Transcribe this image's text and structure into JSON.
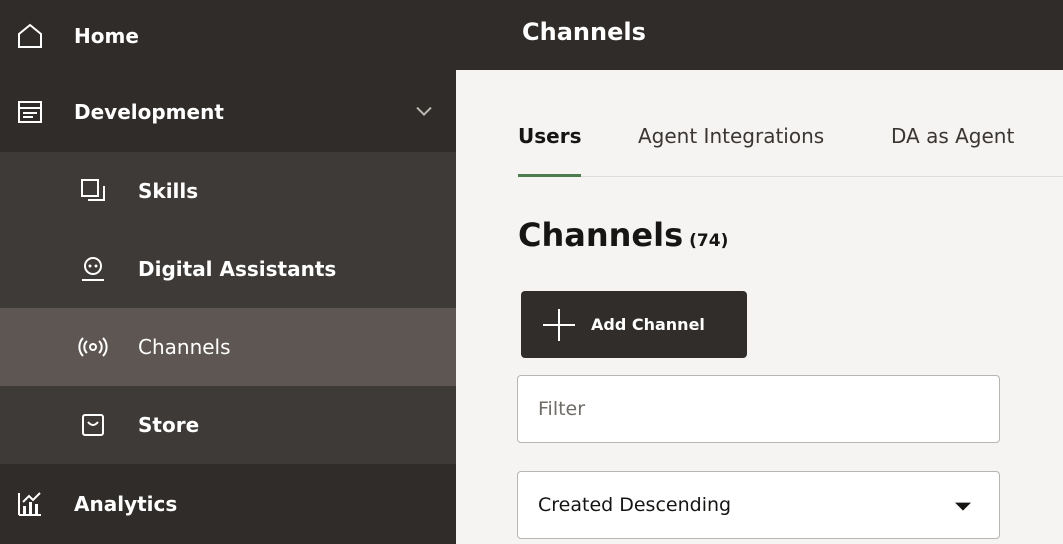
{
  "sidebar": {
    "items": [
      {
        "label": "Home",
        "icon": "home-icon"
      },
      {
        "label": "Development",
        "icon": "development-icon"
      },
      {
        "label": "Skills",
        "icon": "skills-icon"
      },
      {
        "label": "Digital Assistants",
        "icon": "digital-assistant-icon"
      },
      {
        "label": "Channels",
        "icon": "channels-icon"
      },
      {
        "label": "Store",
        "icon": "store-icon"
      },
      {
        "label": "Analytics",
        "icon": "analytics-icon"
      }
    ]
  },
  "header": {
    "title": "Channels"
  },
  "tabs": [
    {
      "label": "Users"
    },
    {
      "label": "Agent Integrations"
    },
    {
      "label": "DA as Agent"
    }
  ],
  "main": {
    "title": "Channels",
    "count": "(74)",
    "add_button": "Add Channel",
    "filter_placeholder": "Filter",
    "sort_value": "Created Descending"
  },
  "colors": {
    "sidebar_bg": "#2f2c29",
    "selected_bg": "#5d5652",
    "tab_indicator": "#4d7c4e"
  }
}
